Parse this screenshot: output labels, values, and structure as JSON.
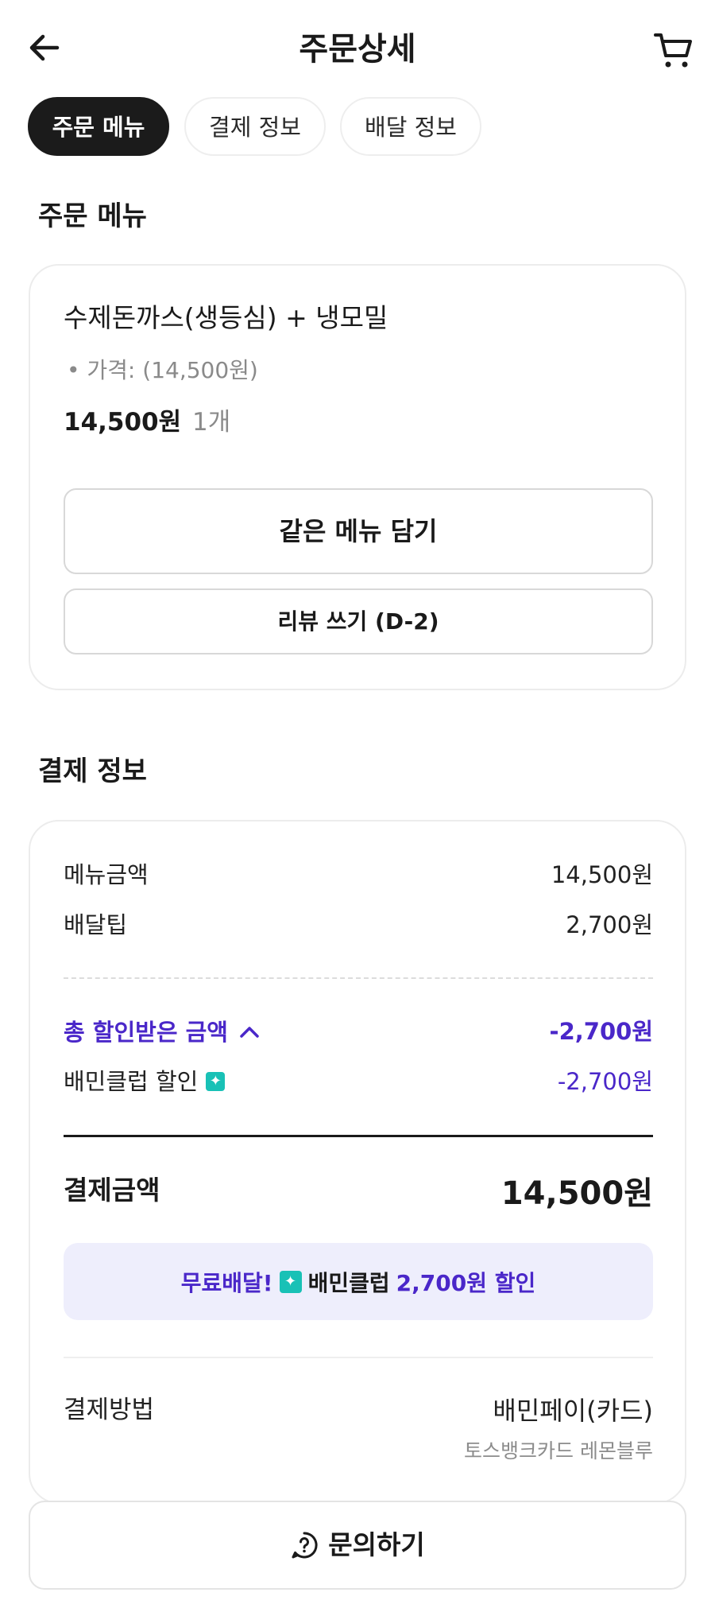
{
  "header": {
    "title": "주문상세"
  },
  "tabs": [
    {
      "label": "주문 메뉴"
    },
    {
      "label": "결제 정보"
    },
    {
      "label": "배달 정보"
    }
  ],
  "order_menu": {
    "section_title": "주문 메뉴",
    "item_name": "수제돈까스(생등심) + 냉모밀",
    "option": "• 가격: (14,500원)",
    "price": "14,500원",
    "quantity": "1개",
    "add_same_button": "같은 메뉴 담기",
    "review_button": "리뷰 쓰기 (D-2)"
  },
  "payment": {
    "section_title": "결제 정보",
    "menu_amount_label": "메뉴금액",
    "menu_amount_value": "14,500원",
    "delivery_tip_label": "배달팁",
    "delivery_tip_value": "2,700원",
    "total_discount_label": "총 할인받은 금액",
    "total_discount_value": "-2,700원",
    "club_discount_label": "배민클럽 할인",
    "club_discount_value": "-2,700원",
    "pay_amount_label": "결제금액",
    "pay_amount_value": "14,500원",
    "banner_free": "무료배달!",
    "banner_club": "배민클럽",
    "banner_discount": "2,700원 할인",
    "method_label": "결제방법",
    "method_value": "배민페이(카드)",
    "card_name": "토스뱅크카드 레몬블루"
  },
  "inquiry": {
    "label": "문의하기"
  },
  "colors": {
    "accent_purple": "#4a27c9",
    "club_mint": "#19c1b6",
    "banner_bg": "#eeeefc"
  }
}
